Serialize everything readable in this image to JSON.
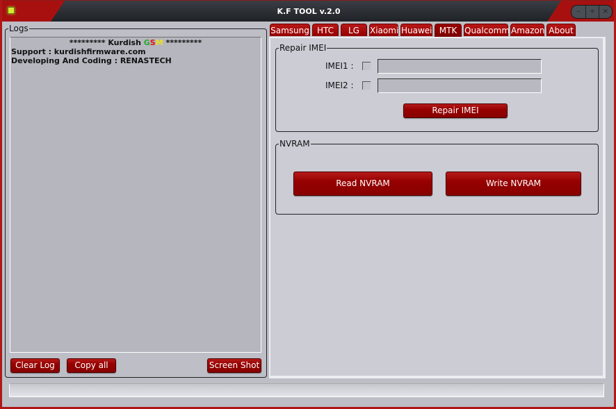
{
  "window": {
    "title": "K.F TOOL v.2.0",
    "controls": {
      "minimize": "–",
      "maximize": "÷",
      "close": "×"
    }
  },
  "logs": {
    "group_label": "Logs",
    "banner": {
      "stars_left": "********* ",
      "name": "Kurdish ",
      "g": "G",
      "s": "S",
      "m": "M",
      "stars_right": " *********"
    },
    "lines": [
      "Support : kurdishfirmware.com",
      "Developing And Coding : RENASTECH"
    ],
    "buttons": {
      "clear": "Clear Log",
      "copy": "Copy all",
      "screenshot": "Screen Shot"
    }
  },
  "tabs": [
    {
      "label": "Samsung",
      "active": false
    },
    {
      "label": "HTC",
      "active": false
    },
    {
      "label": "LG",
      "active": false
    },
    {
      "label": "Xiaomi",
      "active": false
    },
    {
      "label": "Huawei",
      "active": false
    },
    {
      "label": "MTK",
      "active": true
    },
    {
      "label": "Qualcomm",
      "active": false
    },
    {
      "label": "Amazon",
      "active": false
    },
    {
      "label": "About",
      "active": false
    }
  ],
  "repair_imei": {
    "group_label": "Repair IMEI",
    "imei1_label": "IMEI1 :",
    "imei2_label": "IMEI2 :",
    "imei1_value": "",
    "imei2_value": "",
    "imei1_checked": false,
    "imei2_checked": false,
    "button": "Repair IMEI"
  },
  "nvram": {
    "group_label": "NVRAM",
    "read_button": "Read NVRAM",
    "write_button": "Write NVRAM"
  },
  "status": {
    "text": ""
  }
}
